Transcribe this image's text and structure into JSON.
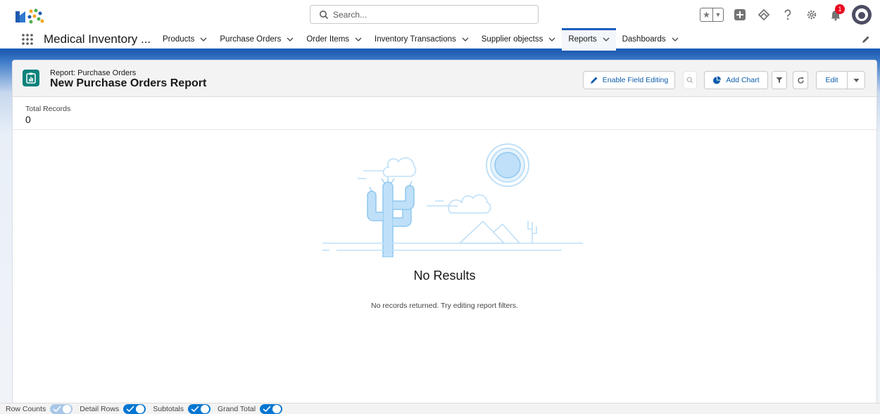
{
  "header": {
    "search_placeholder": "Search..."
  },
  "nav": {
    "app_name": "Medical Inventory ...",
    "items": [
      {
        "label": "Products"
      },
      {
        "label": "Purchase Orders"
      },
      {
        "label": "Order Items"
      },
      {
        "label": "Inventory Transactions"
      },
      {
        "label": "Supplier objectss"
      },
      {
        "label": "Reports",
        "active": true
      },
      {
        "label": "Dashboards"
      }
    ]
  },
  "report": {
    "type_label": "Report: Purchase Orders",
    "title": "New Purchase Orders Report",
    "buttons": {
      "enable_field_editing": "Enable Field Editing",
      "add_chart": "Add Chart",
      "edit": "Edit"
    },
    "summary": {
      "label": "Total Records",
      "value": "0"
    },
    "empty": {
      "title": "No Results",
      "subtitle": "No records returned. Try editing report filters."
    }
  },
  "footer": {
    "toggles": [
      {
        "label": "Row Counts",
        "on": true,
        "disabled": true
      },
      {
        "label": "Detail Rows",
        "on": true
      },
      {
        "label": "Subtotals",
        "on": true
      },
      {
        "label": "Grand Total",
        "on": true
      }
    ]
  },
  "notifications": {
    "count": "1"
  },
  "colors": {
    "accent": "#0176d3",
    "nav_active": "#1b5fbd",
    "report_icon": "#0b827c",
    "illustration": "#bfe0f8"
  }
}
